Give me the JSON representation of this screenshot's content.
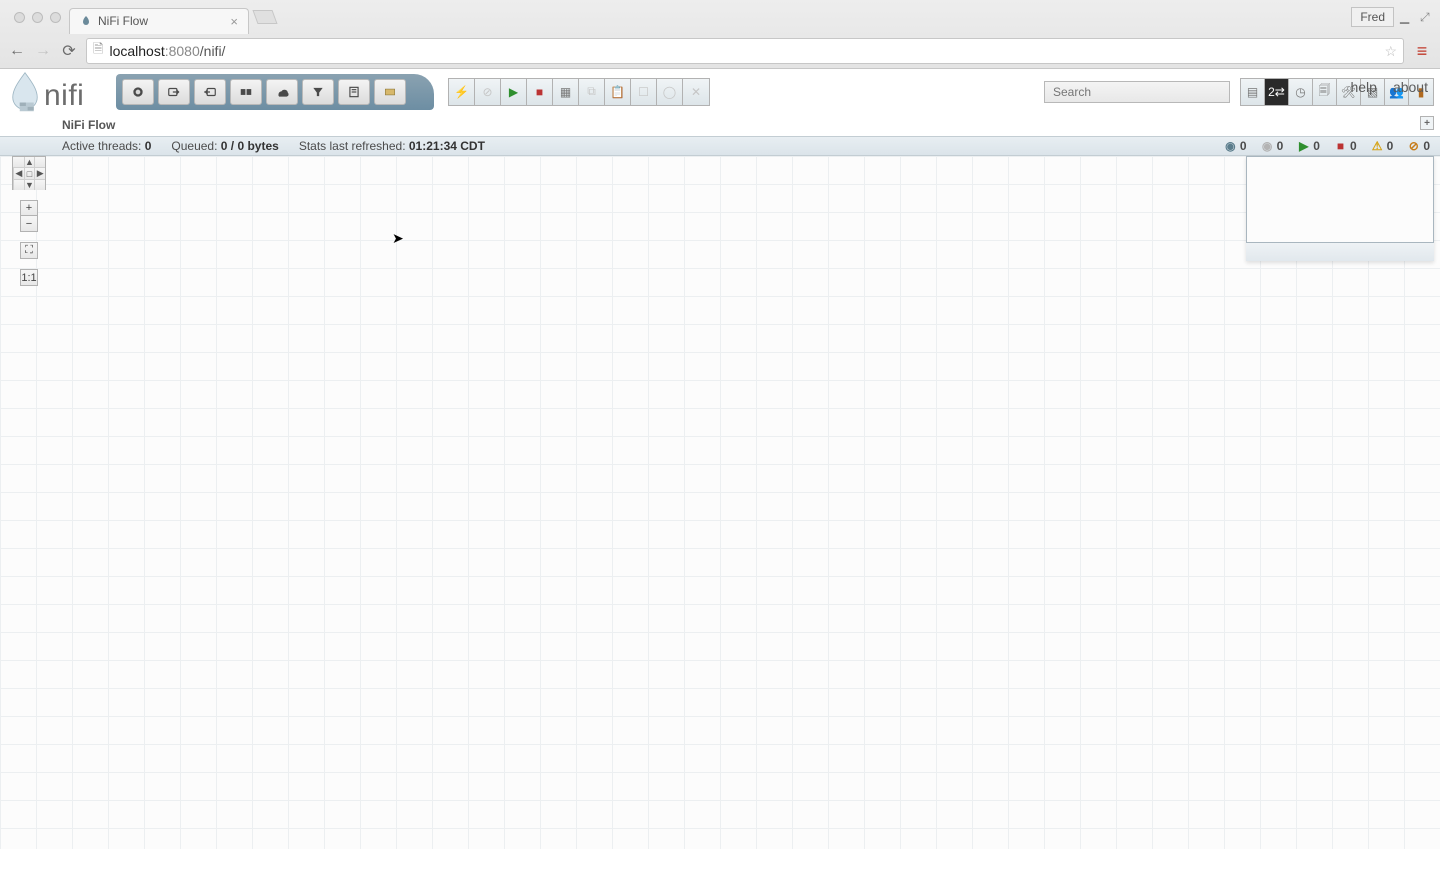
{
  "browser": {
    "tab_title": "NiFi Flow",
    "user_button": "Fred",
    "url_host": "localhost",
    "url_port": ":8080",
    "url_path": "/nifi/"
  },
  "links": {
    "help": "help",
    "about": "about"
  },
  "logo_text": "nifi",
  "palette": [
    "processor",
    "input-port",
    "output-port",
    "process-group",
    "remote-process-group",
    "funnel",
    "template",
    "label"
  ],
  "actions": [
    "enable",
    "disable",
    "start",
    "stop",
    "template-create",
    "copy",
    "paste",
    "group",
    "color",
    "delete"
  ],
  "search": {
    "placeholder": "Search"
  },
  "mgmt": [
    "summary",
    "counters",
    "history",
    "provenance",
    "settings",
    "cluster",
    "users",
    "bulletins"
  ],
  "breadcrumb": "NiFi Flow",
  "stats": {
    "active_label": "Active threads: ",
    "active_value": "0",
    "queued_label": "Queued: ",
    "queued_value": "0 / 0 bytes",
    "refreshed_label": "Stats last refreshed: ",
    "refreshed_value": "01:21:34 CDT"
  },
  "counts": {
    "transmitting": "0",
    "not_transmitting": "0",
    "running": "0",
    "stopped": "0",
    "invalid": "0",
    "disabled": "0"
  }
}
